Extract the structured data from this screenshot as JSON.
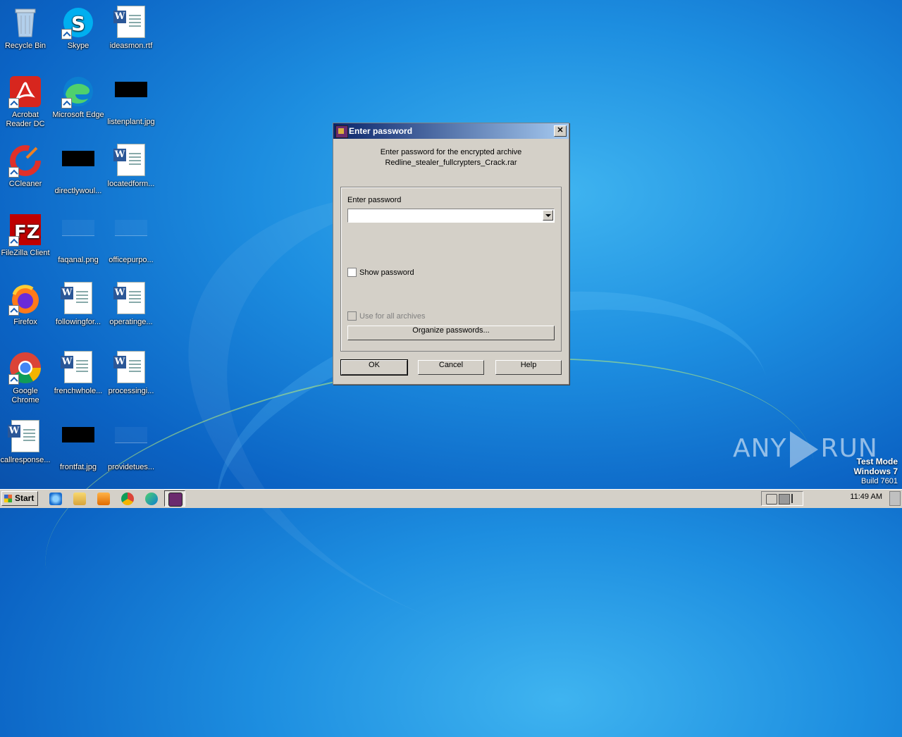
{
  "desktop": {
    "icons": [
      {
        "label": "Recycle Bin",
        "icon": "recycle-bin-icon"
      },
      {
        "label": "Skype",
        "icon": "skype-icon"
      },
      {
        "label": "ideasmon.rtf",
        "icon": "word-doc-icon"
      },
      {
        "label": "Acrobat Reader DC",
        "icon": "acrobat-icon"
      },
      {
        "label": "Microsoft Edge",
        "icon": "edge-icon"
      },
      {
        "label": "listenplant.jpg",
        "icon": "image-thumb-icon"
      },
      {
        "label": "CCleaner",
        "icon": "ccleaner-icon"
      },
      {
        "label": "directlywoul...",
        "icon": "image-thumb-icon"
      },
      {
        "label": "locatedform...",
        "icon": "word-doc-icon"
      },
      {
        "label": "FileZilla Client",
        "icon": "filezilla-icon"
      },
      {
        "label": "faqanal.png",
        "icon": "image-thumb-icon"
      },
      {
        "label": "officepurpo...",
        "icon": "image-thumb-icon"
      },
      {
        "label": "Firefox",
        "icon": "firefox-icon"
      },
      {
        "label": "followingfor...",
        "icon": "word-doc-icon"
      },
      {
        "label": "operatinge...",
        "icon": "word-doc-icon"
      },
      {
        "label": "Google Chrome",
        "icon": "chrome-icon"
      },
      {
        "label": "frenchwhole...",
        "icon": "word-doc-icon"
      },
      {
        "label": "processingi...",
        "icon": "word-doc-icon"
      },
      {
        "label": "callresponse...",
        "icon": "word-doc-icon"
      },
      {
        "label": "frontfat.jpg",
        "icon": "image-thumb-icon"
      },
      {
        "label": "providetues...",
        "icon": "image-thumb-icon"
      }
    ]
  },
  "dialog": {
    "title": "Enter password",
    "close_label": "✕",
    "message_line1": "Enter password for the encrypted archive",
    "message_line2": "Redline_stealer_fullcrypters_Crack.rar",
    "password_label": "Enter password",
    "password_value": "",
    "show_password_label": "Show password",
    "use_for_all_label": "Use for all archives",
    "organize_label": "Organize passwords...",
    "ok_label": "OK",
    "cancel_label": "Cancel",
    "help_label": "Help"
  },
  "taskbar": {
    "start_label": "Start",
    "pinned": [
      "internet-explorer-icon",
      "file-explorer-icon",
      "media-player-icon",
      "chrome-icon",
      "edge-icon",
      "winrar-icon"
    ],
    "clock": "11:49 AM"
  },
  "watermark": {
    "any": "ANY",
    "run": "RUN"
  },
  "os_info": {
    "line1": "Test Mode",
    "line2": "Windows 7",
    "line3": "Build 7601"
  }
}
